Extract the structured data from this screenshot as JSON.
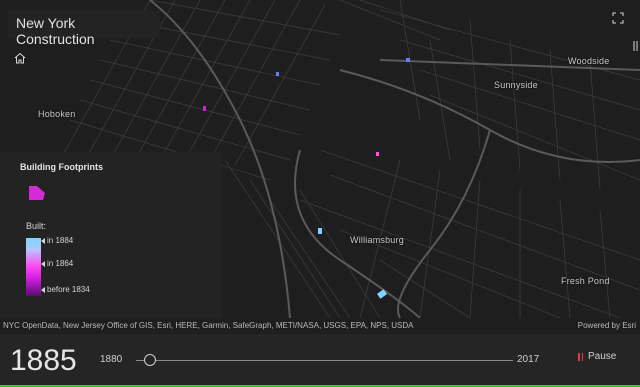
{
  "title": "New York Construction",
  "map": {
    "places": [
      "Woodside",
      "Hoboken",
      "Sunnyside",
      "Williamsburg",
      "Fresh Pond"
    ]
  },
  "legend": {
    "layer_title": "Building Footprints",
    "built_label": "Built:",
    "stops": [
      "in 1884",
      "in 1864",
      "before 1834"
    ],
    "colors": {
      "newest": "#7ad7ff",
      "middle": "#ff4cf3",
      "oldest": "#5b0d72",
      "swatch": "#d42ad8"
    }
  },
  "attribution": {
    "sources": "NYC OpenData, New Jersey Office of GIS, Esri, HERE, Garmin, SafeGraph, METI/NASA, USGS, EPA, NPS, USDA",
    "powered_by": "Powered by Esri"
  },
  "time_slider": {
    "current_year": "1885",
    "min_year": "1880",
    "max_year": "2017",
    "progress": 0.037,
    "pause_label": "Pause"
  },
  "icons": {
    "home": "home-icon",
    "expand": "expand-icon",
    "pause": "pause-icon"
  },
  "accent_color": "#3ec23e"
}
